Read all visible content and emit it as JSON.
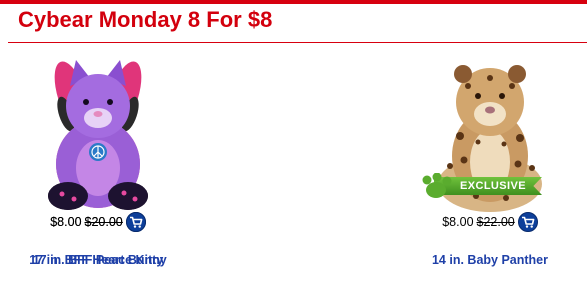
{
  "page": {
    "title": "Cybear Monday 8 For $8"
  },
  "products": [
    {
      "name": "14 in. Baby Panther",
      "sale_price": "$8.00",
      "was_price": "$22.00",
      "badge": "EXCLUSIVE",
      "icon": "cart-icon"
    },
    {
      "name": "17 in. BFF Heart Bunny",
      "sale_price": "$8.00",
      "was_price": "$20.00",
      "icon": "cart-icon"
    },
    {
      "name": "17 in. BFF Peace Kitty",
      "sale_price": "$8.00",
      "was_price": "$20.00",
      "icon": "cart-icon"
    }
  ],
  "colors": {
    "accent_red": "#d3000d",
    "link_blue": "#1f40a8",
    "cart_blue": "#0d3f9a",
    "badge_green": "#5aac2e"
  }
}
